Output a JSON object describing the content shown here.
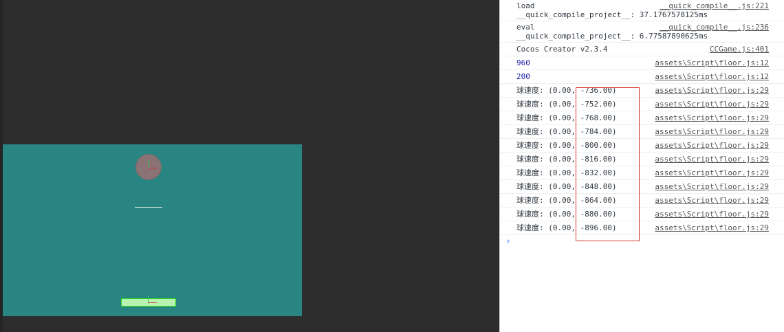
{
  "console": {
    "entries": [
      {
        "line1": "load",
        "line2": "__quick_compile_project__: 37.1767578125ms",
        "source": "__quick_compile__.js:221"
      },
      {
        "line1": "eval",
        "line2": "__quick_compile_project__: 6.77587890625ms",
        "source": "__quick_compile__.js:236"
      },
      {
        "text": "Cocos Creator v2.3.4",
        "source": "CCGame.js:401"
      },
      {
        "text": "960",
        "source": "assets\\Script\\floor.js:12",
        "numeric": true
      },
      {
        "text": "200",
        "source": "assets\\Script\\floor.js:12",
        "numeric": true
      },
      {
        "text": "球速度: (0.00, -736.00)",
        "source": "assets\\Script\\floor.js:29"
      },
      {
        "text": "球速度: (0.00, -752.00)",
        "source": "assets\\Script\\floor.js:29"
      },
      {
        "text": "球速度: (0.00, -768.00)",
        "source": "assets\\Script\\floor.js:29"
      },
      {
        "text": "球速度: (0.00, -784.00)",
        "source": "assets\\Script\\floor.js:29"
      },
      {
        "text": "球速度: (0.00, -800.00)",
        "source": "assets\\Script\\floor.js:29"
      },
      {
        "text": "球速度: (0.00, -816.00)",
        "source": "assets\\Script\\floor.js:29"
      },
      {
        "text": "球速度: (0.00, -832.00)",
        "source": "assets\\Script\\floor.js:29"
      },
      {
        "text": "球速度: (0.00, -848.00)",
        "source": "assets\\Script\\floor.js:29"
      },
      {
        "text": "球速度: (0.00, -864.00)",
        "source": "assets\\Script\\floor.js:29"
      },
      {
        "text": "球速度: (0.00, -880.00)",
        "source": "assets\\Script\\floor.js:29"
      },
      {
        "text": "球速度: (0.00, -896.00)",
        "source": "assets\\Script\\floor.js:29"
      }
    ],
    "prompt": "›"
  },
  "colors": {
    "stage": "#288582",
    "ball": "#8b7375",
    "floor": "#b6f3b0",
    "highlight": "#d4372d"
  }
}
